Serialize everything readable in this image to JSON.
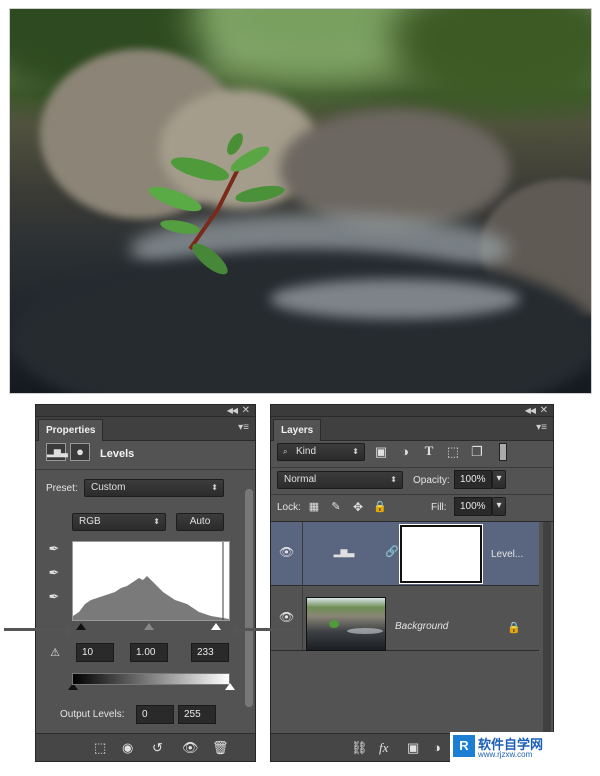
{
  "photo": {
    "alt": "plant on wet rocks"
  },
  "properties": {
    "tab": "Properties",
    "adjustment_title": "Levels",
    "preset_label": "Preset:",
    "preset_value": "Custom",
    "channel_value": "RGB",
    "auto_button": "Auto",
    "input_black": "10",
    "input_gamma": "1.00",
    "input_white": "233",
    "output_label": "Output Levels:",
    "output_black": "0",
    "output_white": "255"
  },
  "layers": {
    "tab": "Layers",
    "filter_kind": "Kind",
    "blend_mode": "Normal",
    "opacity_label": "Opacity:",
    "opacity_value": "100%",
    "lock_label": "Lock:",
    "fill_label": "Fill:",
    "fill_value": "100%",
    "items": [
      {
        "name": "Level...",
        "type": "adjustment",
        "selected": true
      },
      {
        "name": "Background",
        "type": "image",
        "locked": true
      }
    ]
  },
  "watermark": {
    "text": "软件自学网",
    "url": "www.rjzxw.com"
  },
  "colors": {
    "panel_bg": "#535353",
    "selected_layer": "#5a6580",
    "panel_dark": "#2b2b2b"
  }
}
